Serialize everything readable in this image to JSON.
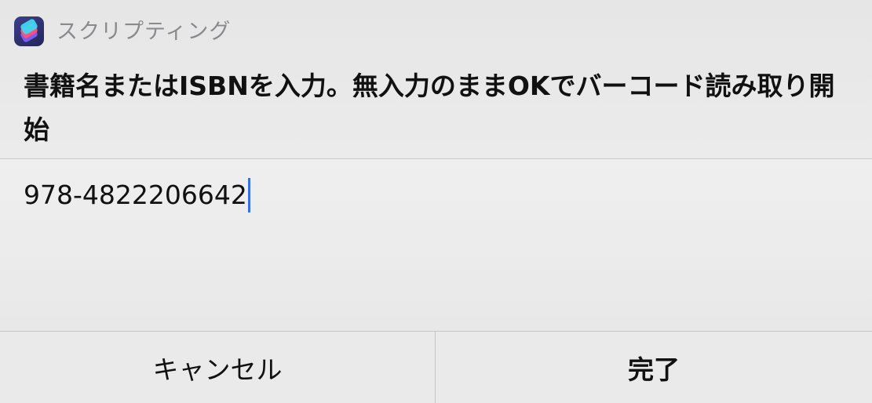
{
  "app": {
    "name": "スクリプティング",
    "icon": "shortcuts-app-icon"
  },
  "prompt": {
    "text": "書籍名またはISBNを入力。無入力のままOKでバーコード読み取り開始"
  },
  "input": {
    "value": "978-4822206642"
  },
  "buttons": {
    "cancel_label": "キャンセル",
    "done_label": "完了"
  },
  "colors": {
    "caret": "#3a6ee8",
    "background": "#ebebeb",
    "divider": "#c6c6c6"
  }
}
